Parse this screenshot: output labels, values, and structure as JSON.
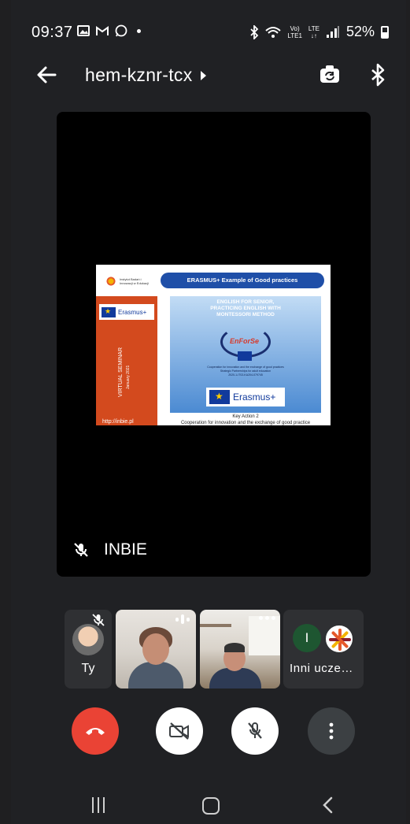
{
  "status_bar": {
    "time": "09:37",
    "signal_label_top": "Vo)",
    "signal_label_bottom": "LTE1",
    "network_top": "LTE",
    "network_bottom": "↓↑",
    "battery": "52%"
  },
  "top_bar": {
    "meeting_code": "hem-kznr-tcx"
  },
  "main_tile": {
    "participant_name": "INBIE",
    "slide": {
      "header": "ERASMUS+ Example of  Good practices",
      "institute_name": "Instytut Badań i Innowacji w Edukacji",
      "erasmus_label": "Erasmus+",
      "seminar": "VIRTUAL SEMINAR",
      "seminar_date": "January 2021",
      "link_fragment": "http://inbie.pl",
      "panel_title_1": "ENGLISH FOR SENIOR,",
      "panel_title_2": "PRACTICING ENGLISH WITH",
      "panel_title_3": "MONTESSORI METHOD",
      "wreath_text": "EnForSe",
      "panel_small_1": "Cooperation for innovation and the exchange of good practices",
      "panel_small_2": "Strategic Partnerships for adult education",
      "panel_small_3": "2020-1-IT02-KA204-079745",
      "panel_erasmus": "Erasmus+",
      "key_action": "Key Action 2",
      "cooperation": "Cooperation for innovation and  the exchange of good practice"
    }
  },
  "filmstrip": {
    "self_label": "Ty",
    "others_initial": "I",
    "others_label": "Inni ucze…"
  },
  "colors": {
    "background": "#202124",
    "end_call": "#ea4335",
    "button_light": "#ffffff",
    "button_dark": "#3c4043"
  },
  "icons": [
    "back-arrow-icon",
    "caret-icon",
    "switch-camera-icon",
    "bluetooth-icon",
    "mic-off-icon",
    "end-call-icon",
    "camera-off-icon",
    "more-vert-icon",
    "recent-apps-icon",
    "home-icon",
    "back-icon"
  ]
}
